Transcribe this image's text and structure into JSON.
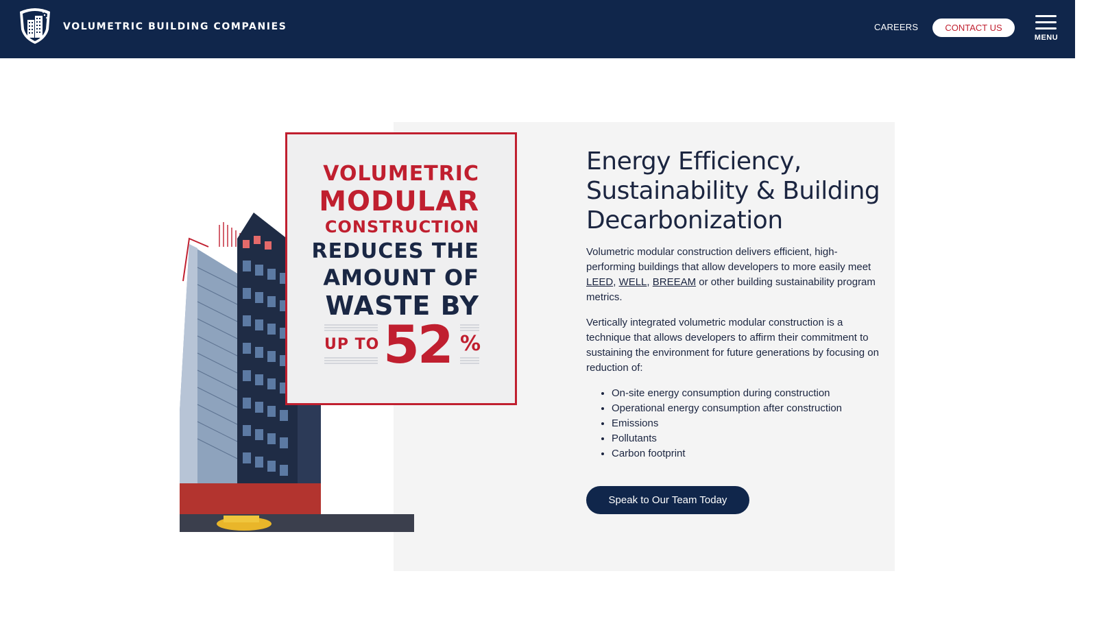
{
  "header": {
    "brand": "VOLUMETRIC BUILDING COMPANIES",
    "nav": {
      "careers": "CAREERS",
      "contact": "CONTACT US",
      "menu": "MENU"
    }
  },
  "stat": {
    "line1": "VOLUMETRIC",
    "line2": "MODULAR",
    "line3": "CONSTRUCTION",
    "line4": "REDUCES THE",
    "line5": "AMOUNT OF",
    "line6": "WASTE BY",
    "up_to": "UP TO",
    "number": "52",
    "percent": "%"
  },
  "content": {
    "heading_line1": "Energy Efficiency,",
    "heading_line2": "Sustainability & Building",
    "heading_line3": "Decarbonization",
    "para1_start": "Volumetric modular construction delivers efficient, high-performing buildings that allow developers to more easily meet ",
    "links": [
      "LEED",
      "WELL",
      "BREEAM"
    ],
    "para1_end": " or other building sustainability program metrics.",
    "para2": "Vertically integrated volumetric modular construction is a technique that allows developers to affirm their commitment to sustaining the environment for future generations by focusing on reduction of:",
    "bullets": [
      "On-site energy consumption during construction",
      "Operational energy consumption after construction",
      "Emissions",
      "Pollutants",
      "Carbon footprint"
    ],
    "cta": "Speak to Our Team Today"
  },
  "colors": {
    "navy": "#10264b",
    "red": "#c01f2f",
    "panel": "#f4f4f4"
  },
  "icons": {
    "logo": "shield-building-logo-icon",
    "menu": "hamburger-menu-icon"
  }
}
